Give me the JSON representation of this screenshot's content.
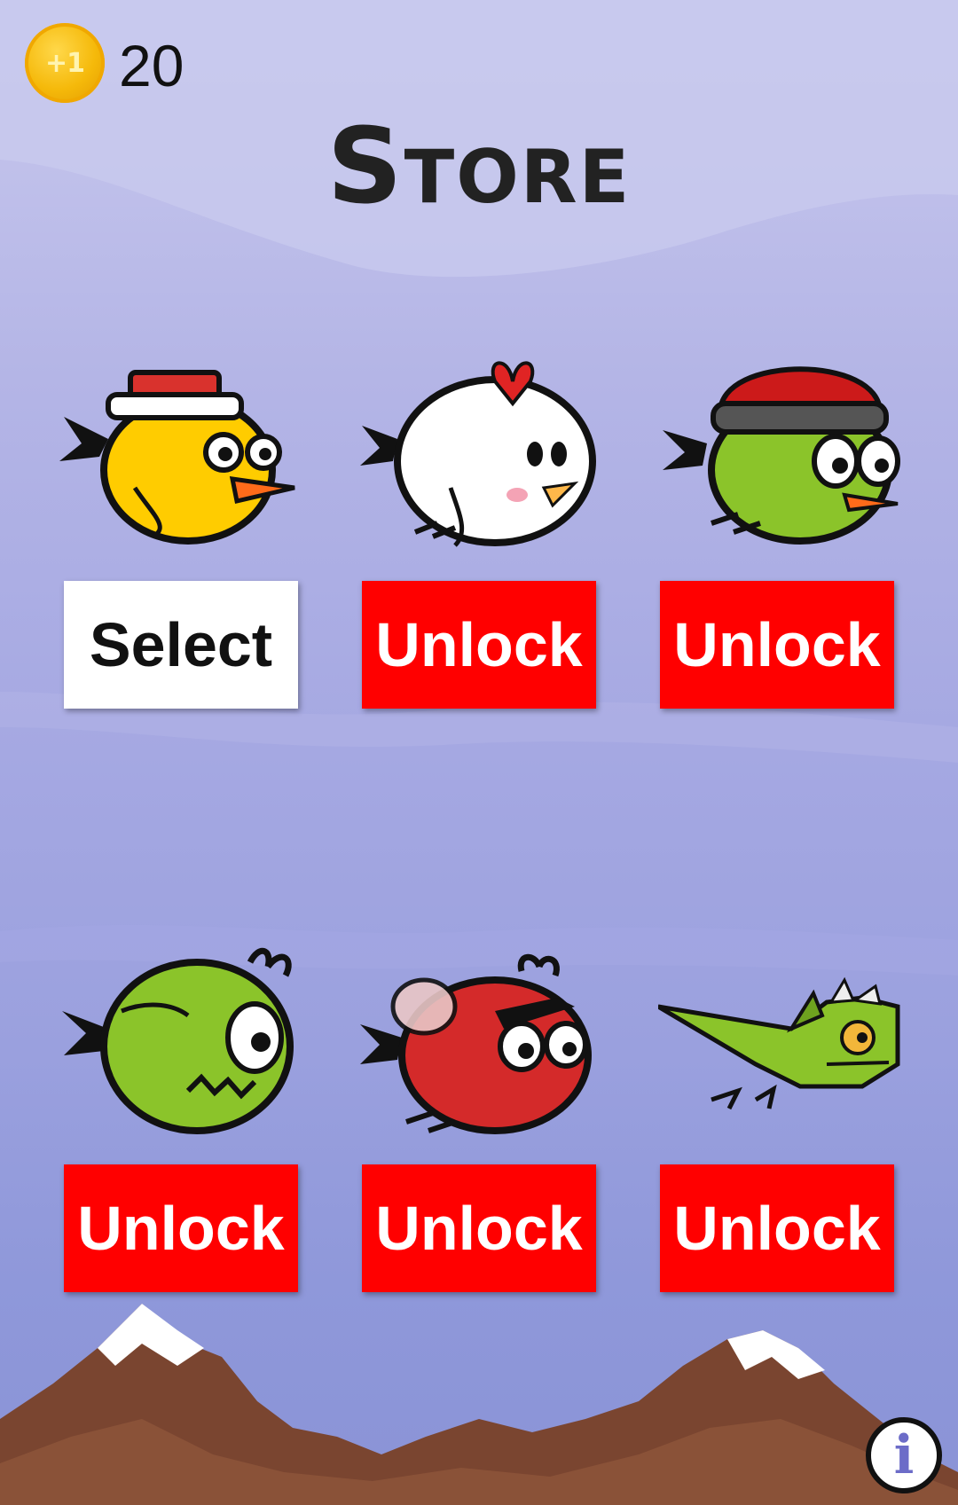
{
  "hud": {
    "coin_badge": "+1",
    "coin_count": "20"
  },
  "title": "Store",
  "items": [
    {
      "character": "yellow-bird-with-red-hat",
      "button_label": "Select",
      "state": "owned"
    },
    {
      "character": "white-chicken-bird",
      "button_label": "Unlock",
      "state": "locked"
    },
    {
      "character": "green-bird-with-beanie",
      "button_label": "Unlock",
      "state": "locked"
    },
    {
      "character": "green-zombie-bird",
      "button_label": "Unlock",
      "state": "locked"
    },
    {
      "character": "red-angry-fly-bird",
      "button_label": "Unlock",
      "state": "locked"
    },
    {
      "character": "green-dragon",
      "button_label": "Unlock",
      "state": "locked"
    }
  ],
  "info_button": {
    "icon": "info-icon",
    "glyph": "i"
  },
  "colors": {
    "unlock_button": "#ff0000",
    "select_button": "#ffffff",
    "sky_top": "#c9c9ee",
    "sky_bottom": "#8a93d6",
    "coin": "#f5b90a"
  }
}
